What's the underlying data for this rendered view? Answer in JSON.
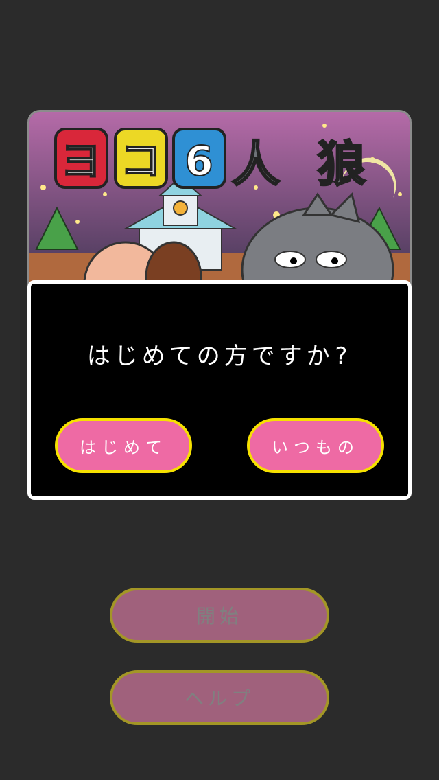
{
  "banner": {
    "title_text": "ヨコ6人狼"
  },
  "dialog": {
    "question": "はじめての方ですか?",
    "first_time_label": "はじめて",
    "usual_label": "いつもの"
  },
  "menu": {
    "start_label": "開始",
    "help_label": "ヘルプ"
  },
  "colors": {
    "background": "#2b2b2b",
    "choice_button_fill": "#ee6aa4",
    "choice_button_border": "#f6e100",
    "menu_button_fill": "#a0617c",
    "menu_button_border": "#a39626",
    "dialog_border": "#ffffff"
  }
}
